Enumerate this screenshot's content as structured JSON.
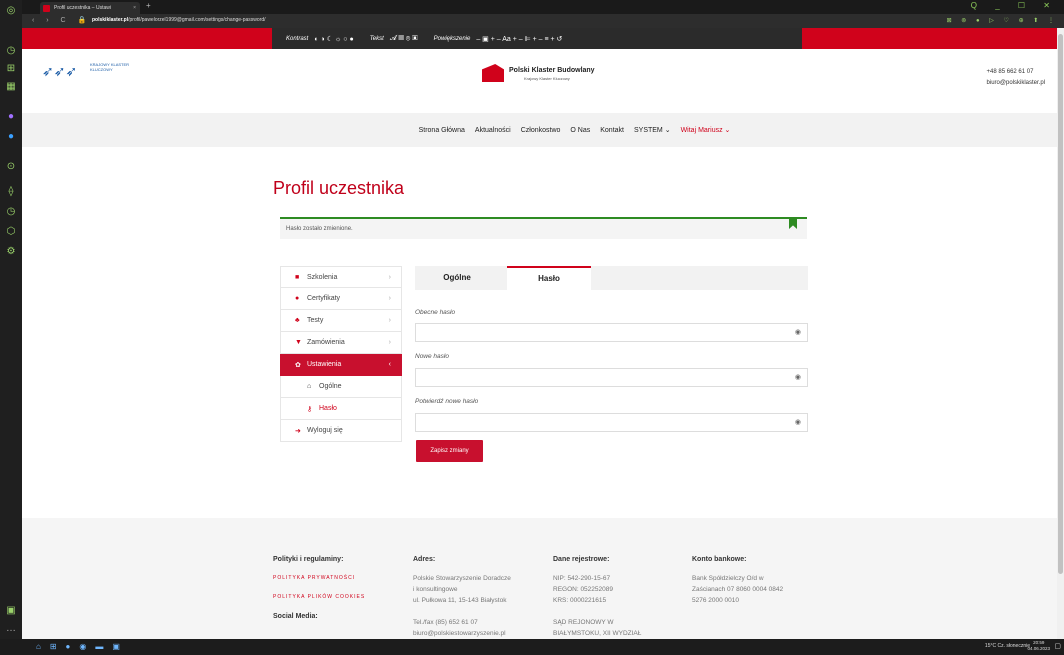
{
  "browser": {
    "tab_title": "Profil uczestnika – Ustawi",
    "tab_close": "×",
    "new_tab": "+",
    "url_host": "polskiklaster.pl",
    "url_path": "/profil/pawelorzel1999@gmail.com/settings/change-password/",
    "nav_icons": "‹ › C 🔒",
    "window_controls": "Q _ ☐ ✕"
  },
  "accessibility_bar": {
    "contrast_label": "Kontrast",
    "text_label": "Tekst",
    "zoom_label": "Powiększenie",
    "contrast_icons": "◐ ◑ ☾ ☼ ○ ●",
    "text_icons": "𝓐 ▤ ⊚ ▣",
    "zoom_icons": "– ▣ +   – Aa +   – ⊫ +   – ≡ +   ↺"
  },
  "header": {
    "logo_left_text": "KRAJOWY KLASTER KLUCZOWY",
    "logo_center_name": "Polski Klaster Budowlany",
    "logo_center_sub": "Krajowy Klaster Kluczowy",
    "phone": "+48 85 662 61 07",
    "email": "biuro@polskiklaster.pl"
  },
  "nav": {
    "items": [
      "Strona Główna",
      "Aktualności",
      "Członkostwo",
      "O Nas",
      "Kontakt",
      "SYSTEM ⌄"
    ],
    "user": "Witaj Mariusz ⌄"
  },
  "page_title": "Profil uczestnika",
  "message": "Hasło zostało zmienione.",
  "sidebar": {
    "items": [
      {
        "label": "Szkolenia",
        "icon": "bag-icon",
        "glyph": "■"
      },
      {
        "label": "Certyfikaty",
        "icon": "certificate-icon",
        "glyph": "●"
      },
      {
        "label": "Testy",
        "icon": "test-icon",
        "glyph": "♣"
      },
      {
        "label": "Zamówienia",
        "icon": "cart-icon",
        "glyph": "▼"
      },
      {
        "label": "Ustawienia",
        "icon": "gear-icon",
        "glyph": "✿"
      },
      {
        "label": "Ogólne",
        "icon": "home-icon",
        "glyph": "⌂"
      },
      {
        "label": "Hasło",
        "icon": "key-icon",
        "glyph": "⚷"
      },
      {
        "label": "Wyloguj się",
        "icon": "logout-icon",
        "glyph": "➜"
      }
    ],
    "chevron": "›",
    "chevron_open": "‹"
  },
  "tabs": {
    "general": "Ogólne",
    "password": "Hasło"
  },
  "form": {
    "current_label": "Obecne hasło",
    "new_label": "Nowe hasło",
    "confirm_label": "Potwierdź nowe hasło",
    "submit": "Zapisz zmiany",
    "eye": "◉"
  },
  "footer": {
    "col1_title": "Polityki i regulaminy:",
    "col1_links": [
      "POLITYKA PRYWATNOŚCI",
      "POLITYKA PLIKÓW COOKIES"
    ],
    "col1_social": "Social Media:",
    "col2_title": "Adres:",
    "col2_lines": [
      "Polskie Stowarzyszenie Doradcze",
      "i konsultingowe",
      "ul. Pułkowa 11, 15-143 Białystok",
      "",
      "Tel./fax (85) 652 61 07",
      "biuro@polskiestowarzyszenie.pl"
    ],
    "col3_title": "Dane rejestrowe:",
    "col3_lines": [
      "NIP: 542-290-15-67",
      "REGON: 052252089",
      "KRS: 0000221615",
      "",
      "SĄD REJONOWY W",
      "BIAŁYMSTOKU, XII WYDZIAŁ"
    ],
    "col4_title": "Konto bankowe:",
    "col4_lines": [
      "Bank Spółdzielczy O/d w",
      "Zaścianach 07 8060 0004 0842",
      "5276 2000 0010"
    ]
  },
  "taskbar": {
    "weather": "15°C Cz. słonecznie",
    "time": "20:59",
    "date": "04.06.2023"
  }
}
